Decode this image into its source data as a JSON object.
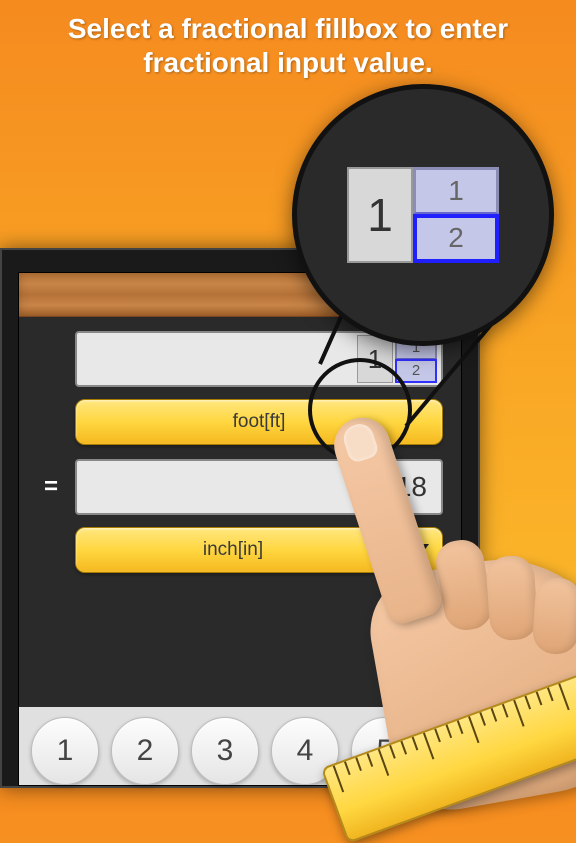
{
  "headline": "Select a fractional fillbox to enter fractional input value.",
  "input": {
    "whole": "1",
    "numerator": "1",
    "denominator": "2"
  },
  "zoom": {
    "whole": "1",
    "numerator": "1",
    "denominator": "2"
  },
  "units": {
    "from": "foot[ft]",
    "to": "inch[in]"
  },
  "result": "18",
  "equals": "=",
  "keypad": [
    "1",
    "2",
    "3",
    "4",
    "5"
  ]
}
